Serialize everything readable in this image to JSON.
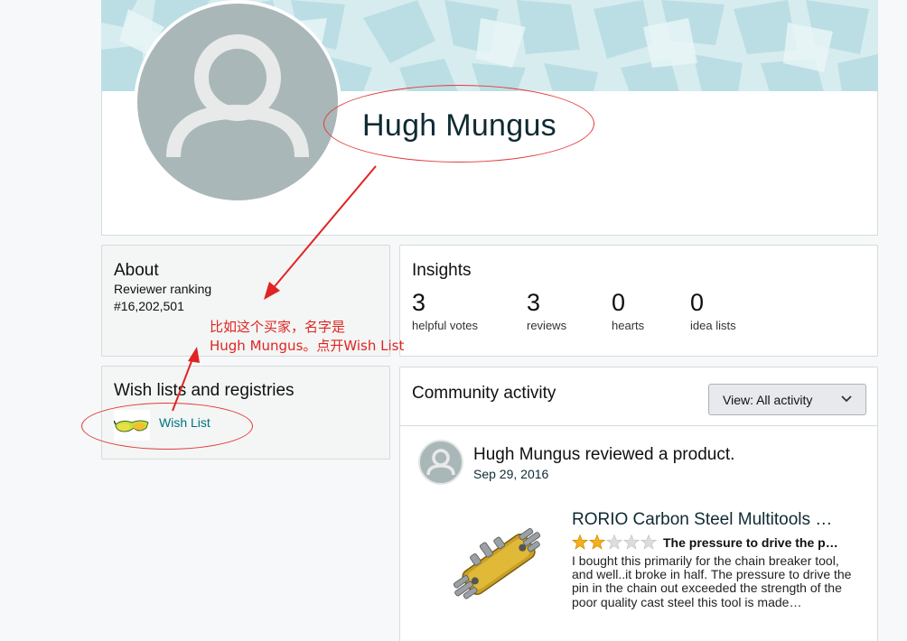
{
  "profile": {
    "name": "Hugh Mungus"
  },
  "about": {
    "title": "About",
    "subtitle": "Reviewer ranking",
    "rank": "#16,202,501"
  },
  "insights": {
    "title": "Insights",
    "stats": [
      {
        "value": "3",
        "label": "helpful votes"
      },
      {
        "value": "3",
        "label": "reviews"
      },
      {
        "value": "0",
        "label": "hearts"
      },
      {
        "value": "0",
        "label": "idea lists"
      }
    ]
  },
  "wishlists": {
    "title": "Wish lists and registries",
    "link_label": "Wish List"
  },
  "community": {
    "title": "Community activity",
    "view_button": "View:  All activity",
    "activity": {
      "headline": "Hugh Mungus reviewed a product.",
      "date": "Sep 29, 2016",
      "product_title": "RORIO Carbon Steel Multitools …",
      "rating": 2,
      "rating_max": 5,
      "review_title": "The pressure to drive the p…",
      "review_body": "I bought this primarily for the chain breaker tool, and well..it broke in half. The pressure to drive the pin in the chain out exceeded the strength of the poor quality cast steel this tool is made…"
    }
  },
  "annotation": {
    "line1": "比如这个买家，名字是",
    "line2": "Hugh Mungus。点开Wish List",
    "color": "#e02424"
  },
  "colors": {
    "link": "#007185",
    "star": "#f2b01e",
    "avatar_bg": "#aab7b8",
    "card_bg": "#f3f6f4"
  }
}
